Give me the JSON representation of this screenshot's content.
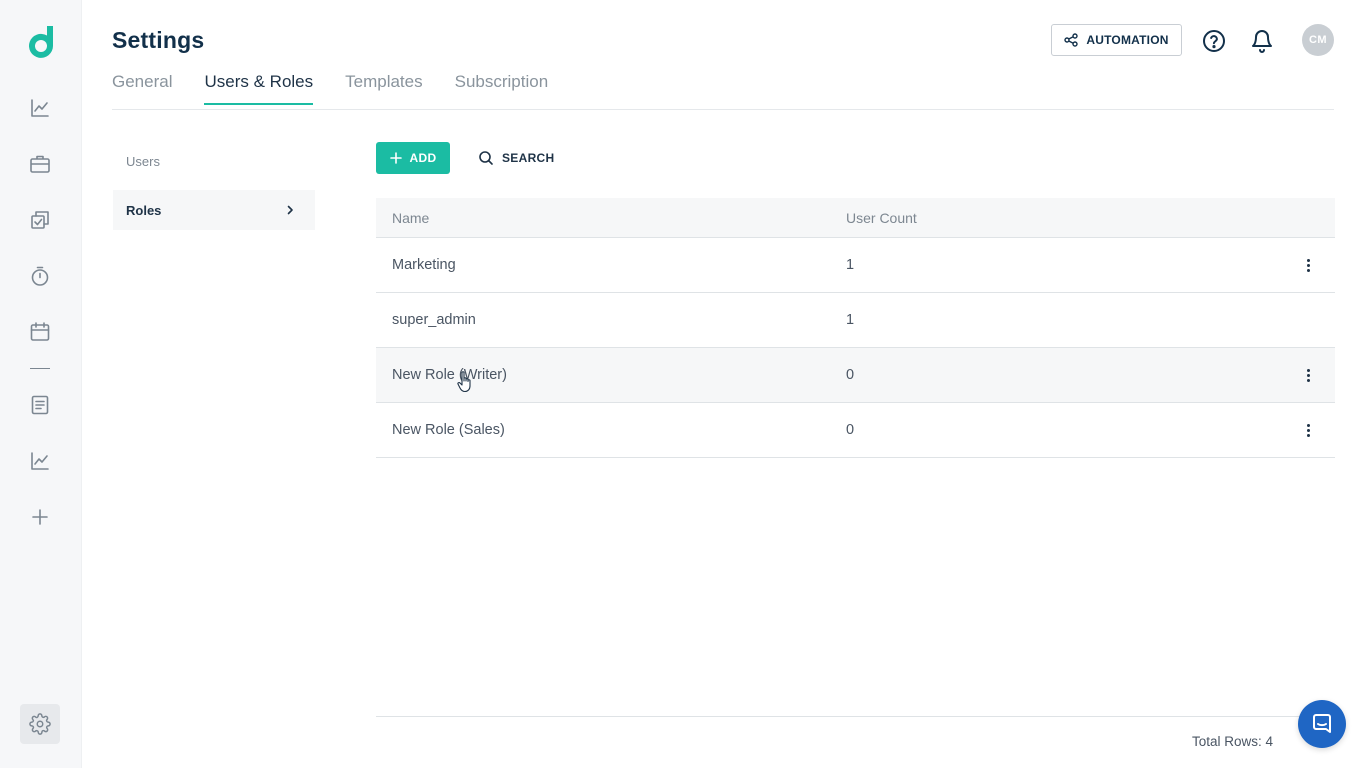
{
  "header": {
    "title": "Settings",
    "automation_label": "AUTOMATION",
    "avatar_initials": "CM"
  },
  "tabs": [
    {
      "label": "General",
      "active": false
    },
    {
      "label": "Users & Roles",
      "active": true
    },
    {
      "label": "Templates",
      "active": false
    },
    {
      "label": "Subscription",
      "active": false
    }
  ],
  "submenu": {
    "users_label": "Users",
    "roles_label": "Roles"
  },
  "toolbar": {
    "add_label": "ADD",
    "search_label": "SEARCH"
  },
  "table": {
    "columns": [
      "Name",
      "User Count"
    ],
    "rows": [
      {
        "name": "Marketing",
        "count": "1"
      },
      {
        "name": "super_admin",
        "count": "1"
      },
      {
        "name": "New Role (Writer)",
        "count": "0"
      },
      {
        "name": "New Role (Sales)",
        "count": "0"
      }
    ],
    "total_rows_label": "Total Rows: 4"
  },
  "colors": {
    "accent": "#1bbca3",
    "title": "#12304a",
    "chat": "#1f66c4"
  },
  "icons": {
    "rail": [
      "line-chart-icon",
      "briefcase-icon",
      "checklist-icon",
      "stopwatch-icon",
      "calendar-icon",
      "document-icon",
      "analytics-icon",
      "plus-icon",
      "gear-icon"
    ],
    "header": [
      "share-icon",
      "help-icon",
      "bell-icon"
    ]
  }
}
